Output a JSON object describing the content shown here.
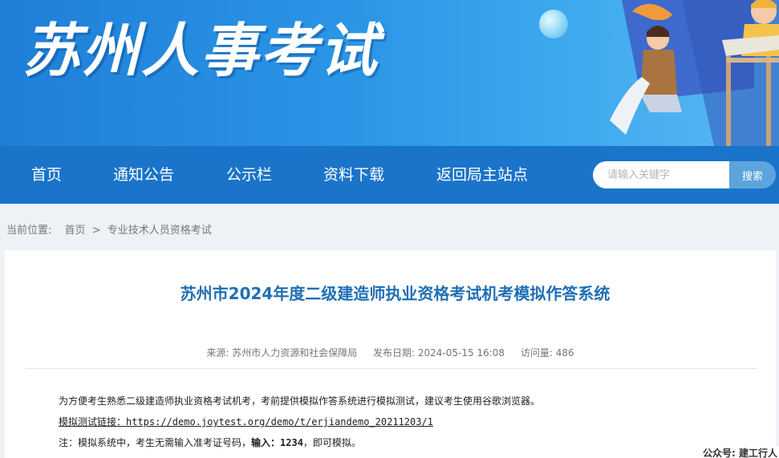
{
  "banner": {
    "title": "苏州人事考试"
  },
  "nav": {
    "items": [
      "首页",
      "通知公告",
      "公示栏",
      "资料下载",
      "返回局主站点"
    ],
    "search_placeholder": "请输入关键字",
    "search_button": "搜索"
  },
  "breadcrumb": {
    "label": "当前位置:",
    "items": [
      "首页",
      "专业技术人员资格考试"
    ],
    "separator": ">"
  },
  "article": {
    "title": "苏州市2024年度二级建造师执业资格考试机考模拟作答系统",
    "source": "来源: 苏州市人力资源和社会保障局",
    "date": "发布日期: 2024-05-15 16:08",
    "views": "访问量: 486",
    "para1": "为方便考生熟悉二级建造师执业资格考试机考，考前提供模拟作答系统进行模拟测试，建议考生使用谷歌浏览器。",
    "link": "模拟测试链接：https://demo.joytest.org/demo/t/erjiandemo_20211203/1",
    "note_prefix": "注：模拟系统中，考生无需输入准考证号码，",
    "note_bold": "输入：1234",
    "note_suffix": "，即可模拟。"
  },
  "watermark": "公众号: 建工行人",
  "colors": {
    "nav": "#1a74c9",
    "title": "#1f6fb4",
    "search_button": "#5da3dc"
  }
}
